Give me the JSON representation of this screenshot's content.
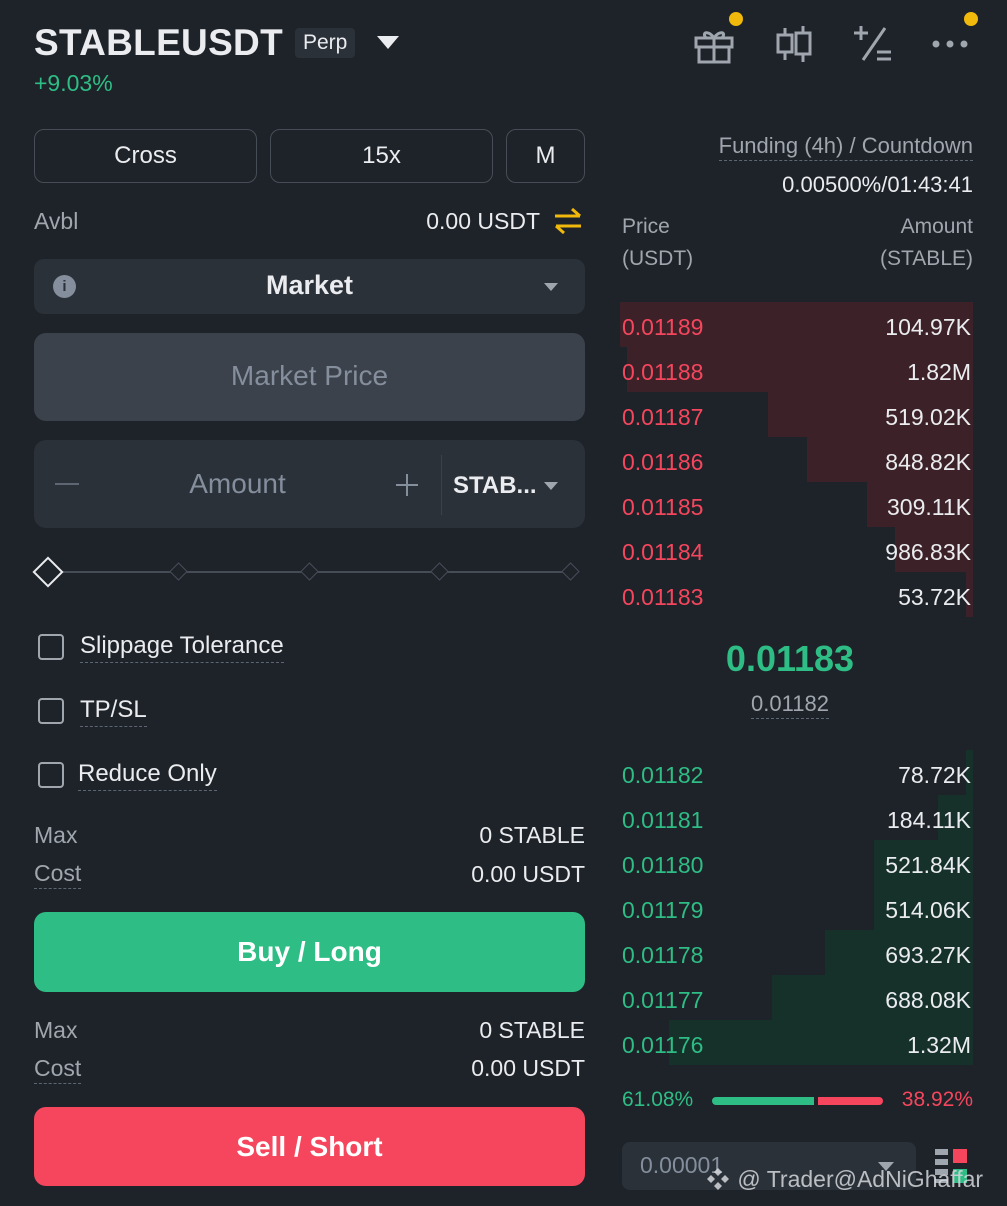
{
  "header": {
    "symbol": "STABLEUSDT",
    "badge": "Perp",
    "change": "+9.03%"
  },
  "order_form": {
    "margin_mode": "Cross",
    "leverage": "15x",
    "asset_mode": "M",
    "avbl_label": "Avbl",
    "avbl_value": "0.00 USDT",
    "order_type": "Market",
    "price_placeholder": "Market Price",
    "amount_placeholder": "Amount",
    "amount_unit": "STAB...",
    "options": [
      {
        "label": "Slippage Tolerance"
      },
      {
        "label": "TP/SL"
      },
      {
        "label": "Reduce Only"
      }
    ],
    "buy_max_label": "Max",
    "buy_max_value": "0 STABLE",
    "buy_cost_label": "Cost",
    "buy_cost_value": "0.00 USDT",
    "buy_label": "Buy / Long",
    "sell_max_label": "Max",
    "sell_max_value": "0 STABLE",
    "sell_cost_label": "Cost",
    "sell_cost_value": "0.00 USDT",
    "sell_label": "Sell / Short"
  },
  "orderbook": {
    "funding_label": "Funding (4h) / Countdown",
    "funding_value": "0.00500%/01:43:41",
    "price_header_1": "Price",
    "price_header_2": "(USDT)",
    "amount_header_1": "Amount",
    "amount_header_2": "(STABLE)",
    "asks": [
      {
        "price": "0.01189",
        "amount": "104.97K",
        "depth": 1.0
      },
      {
        "price": "0.01188",
        "amount": "1.82M",
        "depth": 0.98
      },
      {
        "price": "0.01187",
        "amount": "519.02K",
        "depth": 0.58
      },
      {
        "price": "0.01186",
        "amount": "848.82K",
        "depth": 0.47
      },
      {
        "price": "0.01185",
        "amount": "309.11K",
        "depth": 0.3
      },
      {
        "price": "0.01184",
        "amount": "986.83K",
        "depth": 0.22
      },
      {
        "price": "0.01183",
        "amount": "53.72K",
        "depth": 0.02
      }
    ],
    "mid_price": "0.01183",
    "mark_price": "0.01182",
    "bids": [
      {
        "price": "0.01182",
        "amount": "78.72K",
        "depth": 0.02
      },
      {
        "price": "0.01181",
        "amount": "184.11K",
        "depth": 0.1
      },
      {
        "price": "0.01180",
        "amount": "521.84K",
        "depth": 0.28
      },
      {
        "price": "0.01179",
        "amount": "514.06K",
        "depth": 0.28
      },
      {
        "price": "0.01178",
        "amount": "693.27K",
        "depth": 0.42
      },
      {
        "price": "0.01177",
        "amount": "688.08K",
        "depth": 0.57
      },
      {
        "price": "0.01176",
        "amount": "1.32M",
        "depth": 0.86
      }
    ],
    "buy_ratio": "61.08%",
    "sell_ratio": "38.92%",
    "buy_ratio_value": 61.08,
    "precision": "0.00001"
  },
  "watermark": "@ Trader@AdNiGhaffar",
  "colors": {
    "background": "#1e2329",
    "buy": "#2ebd85",
    "sell": "#f6465d",
    "dot": "#f0b90b"
  }
}
